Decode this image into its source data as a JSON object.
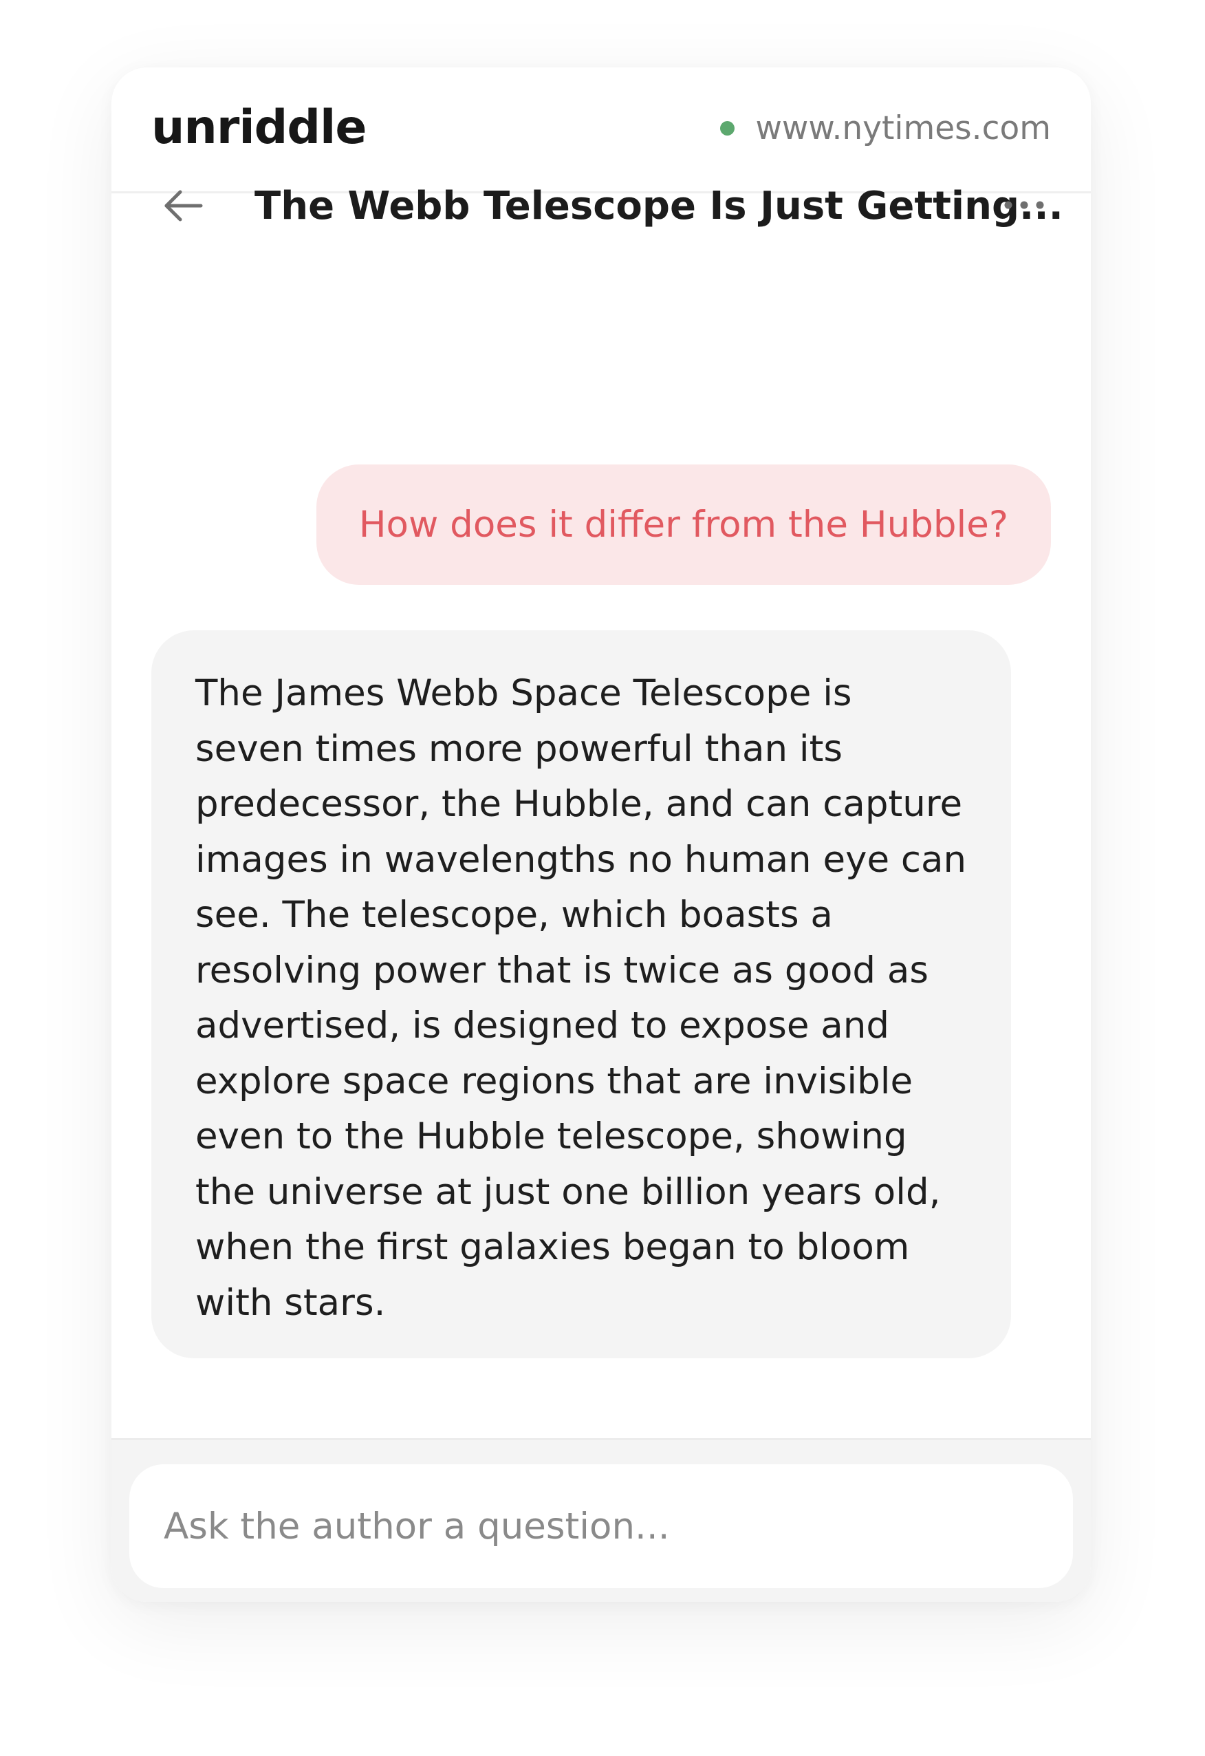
{
  "header": {
    "brand": "unriddle",
    "site": "www.nytimes.com",
    "status_color": "#5ca86e"
  },
  "article": {
    "title": "The Webb Telescope Is Just Getting...",
    "back_icon": "arrow-left-icon",
    "menu_icon": "more-horizontal-icon"
  },
  "chat": {
    "user_message": "How does it differ from the Hubble?",
    "assistant_lines": [
      "The James Webb Space Telescope is",
      "seven times more powerful than its",
      "predecessor, the Hubble, and can capture",
      "images in wavelengths no human eye can",
      "see. The telescope, which boasts a",
      "resolving power that is twice as good as",
      "advertised, is designed to expose and",
      "explore space regions that are invisible",
      "even to the Hubble telescope, showing",
      "the universe at just one billion years old,",
      "when the first galaxies began to bloom",
      "with stars."
    ]
  },
  "composer": {
    "placeholder": "Ask the author a question..."
  },
  "colors": {
    "accent_text": "#e15960",
    "accent_bg": "#fbe7e8",
    "assistant_bg": "#f4f4f4"
  }
}
